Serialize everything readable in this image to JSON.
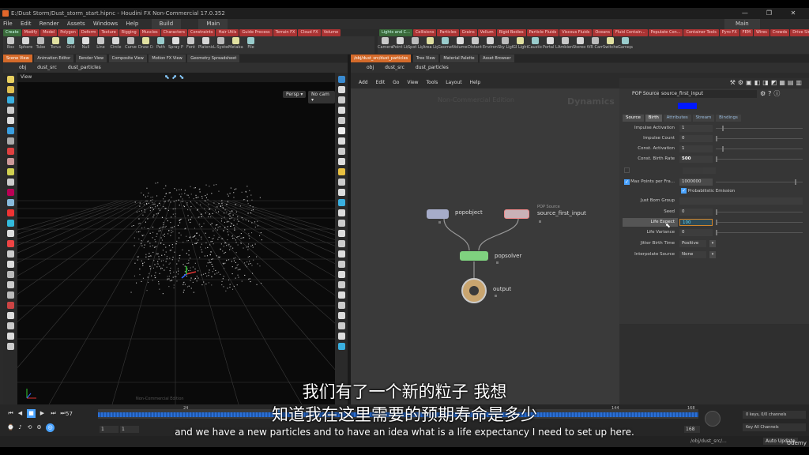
{
  "window": {
    "title": "E:/Dust Storm/Dust_storm_start.hipnc - Houdini FX Non-Commercial 17.0.352",
    "controls": [
      "—",
      "❐",
      "✕"
    ]
  },
  "menubar": {
    "items": [
      "File",
      "Edit",
      "Render",
      "Assets",
      "Windows",
      "Help"
    ],
    "build": "Build",
    "main": "Main"
  },
  "shelf_tabs_left": [
    "Create",
    "Modify",
    "Model",
    "Polygon",
    "Deform",
    "Texture",
    "Rigging",
    "Muscles",
    "Characters",
    "Constraints",
    "Hair Utils",
    "Guide Process",
    "Terrain FX",
    "Cloud FX",
    "Volume"
  ],
  "shelf_tabs_right": [
    "Lights and C...",
    "Collisions",
    "Particles",
    "Grains",
    "Vellum",
    "Rigid Bodies",
    "Particle Fluids",
    "Viscous Fluids",
    "Oceans",
    "Fluid Contain...",
    "Populate Con...",
    "Container Tools",
    "Pyro FX",
    "FEM",
    "Wires",
    "Crowds",
    "Drive Simula..."
  ],
  "shelf_tools_left": [
    "Box",
    "Sphere",
    "Tube",
    "Torus",
    "Grid",
    "Null",
    "Line",
    "Circle",
    "Curve",
    "Draw Curve",
    "Path",
    "Spray Paint",
    "Font",
    "Platonic Solids",
    "L-System",
    "Metaball",
    "File"
  ],
  "shelf_tools_right": [
    "Camera",
    "Point Light",
    "Spot Light",
    "Area Light",
    "Geometry Light",
    "Volume Light",
    "Distant Light",
    "Environment Light",
    "Sky Light",
    "GI Light",
    "Caustic Light",
    "Portal Light",
    "Ambient Light",
    "Stereo Camera",
    "VR Camera",
    "Switcher",
    "Gamepad Camera"
  ],
  "left_pane": {
    "tabs": [
      "Scene View",
      "Animation Editor",
      "Render View",
      "Composite View",
      "Motion FX View",
      "Geometry Spreadsheet"
    ],
    "path": [
      "obj",
      "dust_src",
      "dust_particles"
    ],
    "view_label": "View",
    "persp": "Persp ▾",
    "nocam": "No cam ▾",
    "footer": "Non-Commercial Edition"
  },
  "right_pane": {
    "tabs": [
      "/obj/dust_src/dust_particles",
      "Tree View",
      "Material Palette",
      "Asset Browser"
    ],
    "path": [
      "obj",
      "dust_src",
      "dust_particles"
    ],
    "menu": [
      "Add",
      "Edit",
      "Go",
      "View",
      "Tools",
      "Layout",
      "Help"
    ],
    "watermark": "Non-Commercial Edition",
    "context": "Dynamics"
  },
  "nodes": {
    "popobject": "popobject",
    "source_type": "POP Source",
    "source": "source_first_input",
    "solver": "popsolver",
    "output": "output"
  },
  "params": {
    "node_type": "POP Source",
    "node_name": "source_first_input",
    "tabs": [
      "Source",
      "Birth",
      "Attributes",
      "Stream",
      "Bindings"
    ],
    "rows": [
      {
        "label": "Impulse Activation",
        "value": "1"
      },
      {
        "label": "Impulse Count",
        "value": "0"
      },
      {
        "label": "Const. Activation",
        "value": "1"
      },
      {
        "label": "Const. Birth Rate",
        "value": "500"
      },
      {
        "label": "Max Points per Fra...",
        "value": "1000000"
      }
    ],
    "prob_emission": "Probabilistic Emission",
    "just_born_group": "Just Born Group",
    "seed_label": "Seed",
    "seed_value": "0",
    "life_expect_label": "Life Expect",
    "life_expect_value": "100",
    "life_variance_label": "Life Variance",
    "life_variance_value": "0",
    "jitter_label": "Jitter Birth Time",
    "jitter_value": "Positive",
    "interp_label": "Interpolate Source",
    "interp_value": "None"
  },
  "timeline": {
    "frame": "57",
    "start": "1",
    "end_a": "1",
    "ticks": [
      "24",
      "144",
      "168"
    ],
    "end": "168",
    "keys": "0 keys, 0/0 channels",
    "key_all": "Key All Channels",
    "path": "/obj/dust_src/...",
    "auto": "Auto Update"
  },
  "subtitles": {
    "zh_line1": "我们有了一个新的粒子 我想",
    "zh_line2": "知道我在这里需要的预期寿命是多少",
    "en": "and we have a new particles and to have an idea what is a life expectancy I need to set up here."
  },
  "brand": "Udemy"
}
